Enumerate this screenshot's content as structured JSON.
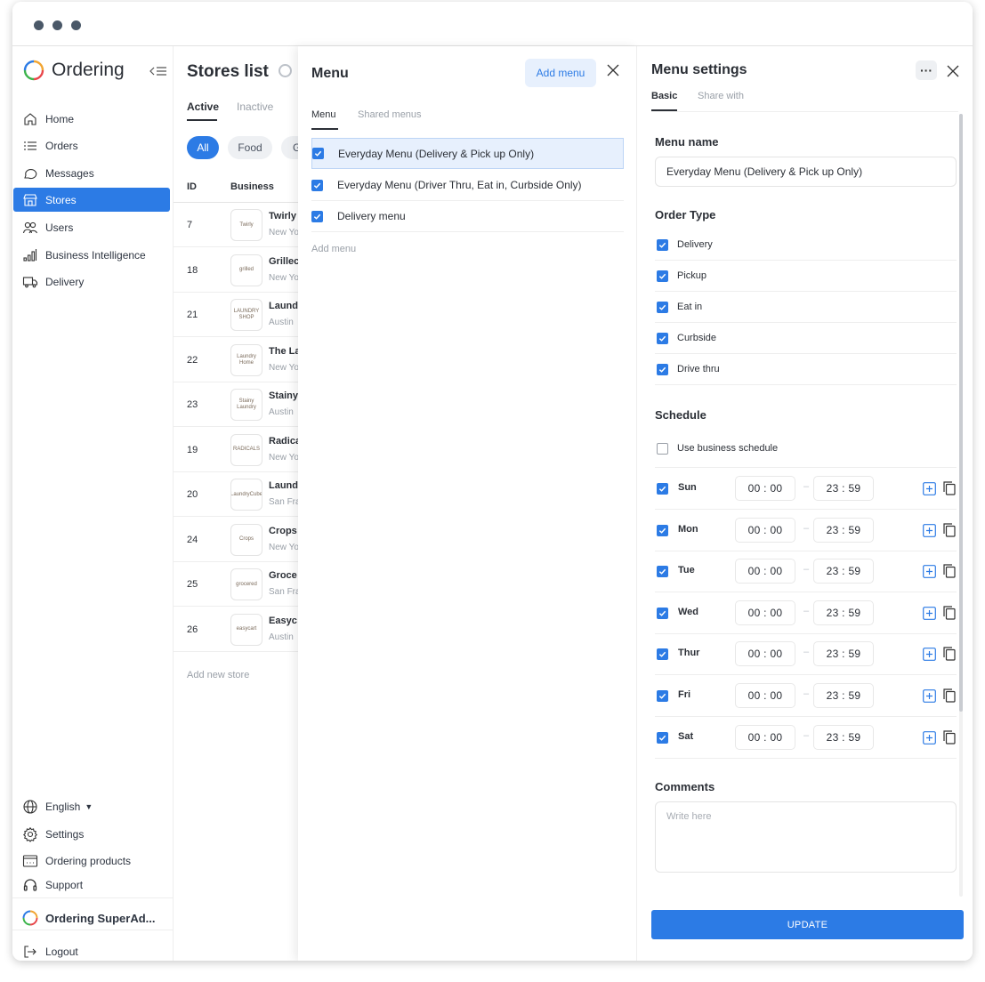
{
  "sidebar": {
    "brand": "Ordering",
    "nav": [
      {
        "label": "Home",
        "icon": "home-icon"
      },
      {
        "label": "Orders",
        "icon": "list-icon"
      },
      {
        "label": "Messages",
        "icon": "chat-icon"
      },
      {
        "label": "Stores",
        "icon": "store-icon",
        "active": true
      },
      {
        "label": "Users",
        "icon": "users-icon"
      },
      {
        "label": "Business Intelligence",
        "icon": "bar-chart-icon"
      },
      {
        "label": "Delivery",
        "icon": "truck-icon"
      }
    ],
    "language": "English",
    "bottom": [
      {
        "label": "Settings",
        "icon": "gear-icon"
      },
      {
        "label": "Ordering products",
        "icon": "products-icon"
      },
      {
        "label": "Support",
        "icon": "headset-icon"
      }
    ],
    "account": "Ordering SuperAd...",
    "logout": "Logout"
  },
  "stores": {
    "title": "Stores list",
    "tabs": [
      "Active",
      "Inactive"
    ],
    "filters": [
      "All",
      "Food",
      "G"
    ],
    "columns": [
      "ID",
      "Business"
    ],
    "rows": [
      {
        "id": "7",
        "name": "Twirly",
        "city": "New Yo",
        "logo": "Twirly"
      },
      {
        "id": "18",
        "name": "Grillec",
        "city": "New Yo",
        "logo": "grilled"
      },
      {
        "id": "21",
        "name": "Laund",
        "city": "Austin",
        "logo": "LAUNDRY SHOP"
      },
      {
        "id": "22",
        "name": "The La",
        "city": "New Yo",
        "logo": "Laundry Home"
      },
      {
        "id": "23",
        "name": "Stainy",
        "city": "Austin",
        "logo": "Stainy Laundry"
      },
      {
        "id": "19",
        "name": "Radica",
        "city": "New Yo",
        "logo": "RADICALS"
      },
      {
        "id": "20",
        "name": "Laund",
        "city": "San Fra",
        "logo": "LaundryCube"
      },
      {
        "id": "24",
        "name": "Crops",
        "city": "New Yo",
        "logo": "Crops"
      },
      {
        "id": "25",
        "name": "Groce",
        "city": "San Fra",
        "logo": "grocered"
      },
      {
        "id": "26",
        "name": "Easyc",
        "city": "Austin",
        "logo": "easycart"
      }
    ],
    "add_new": "Add new store"
  },
  "menu": {
    "title": "Menu",
    "add_button": "Add menu",
    "tabs": [
      "Menu",
      "Shared menus"
    ],
    "items": [
      "Everyday Menu (Delivery & Pick up Only)",
      "Everyday Menu (Driver Thru, Eat in, Curbside Only)",
      "Delivery menu"
    ],
    "add_link": "Add menu"
  },
  "settings": {
    "title": "Menu settings",
    "tabs": [
      "Basic",
      "Share with"
    ],
    "menu_name_label": "Menu name",
    "menu_name_value": "Everyday Menu (Delivery & Pick up Only)",
    "order_type_label": "Order Type",
    "order_types": [
      "Delivery",
      "Pickup",
      "Eat in",
      "Curbside",
      "Drive thru"
    ],
    "schedule_label": "Schedule",
    "use_business_schedule": "Use business schedule",
    "days": [
      {
        "day": "Sun",
        "open": "00 : 00",
        "close": "23 : 59"
      },
      {
        "day": "Mon",
        "open": "00 : 00",
        "close": "23 : 59"
      },
      {
        "day": "Tue",
        "open": "00 : 00",
        "close": "23 : 59"
      },
      {
        "day": "Wed",
        "open": "00 : 00",
        "close": "23 : 59"
      },
      {
        "day": "Thur",
        "open": "00 : 00",
        "close": "23 : 59"
      },
      {
        "day": "Fri",
        "open": "00 : 00",
        "close": "23 : 59"
      },
      {
        "day": "Sat",
        "open": "00 : 00",
        "close": "23 : 59"
      }
    ],
    "time_separator": "–",
    "comments_label": "Comments",
    "comments_placeholder": "Write here",
    "update_button": "UPDATE"
  },
  "colors": {
    "accent": "#2c7be5",
    "accent_light": "#e7f0fd",
    "text": "#2b2f36",
    "muted": "#9aa0a8"
  }
}
